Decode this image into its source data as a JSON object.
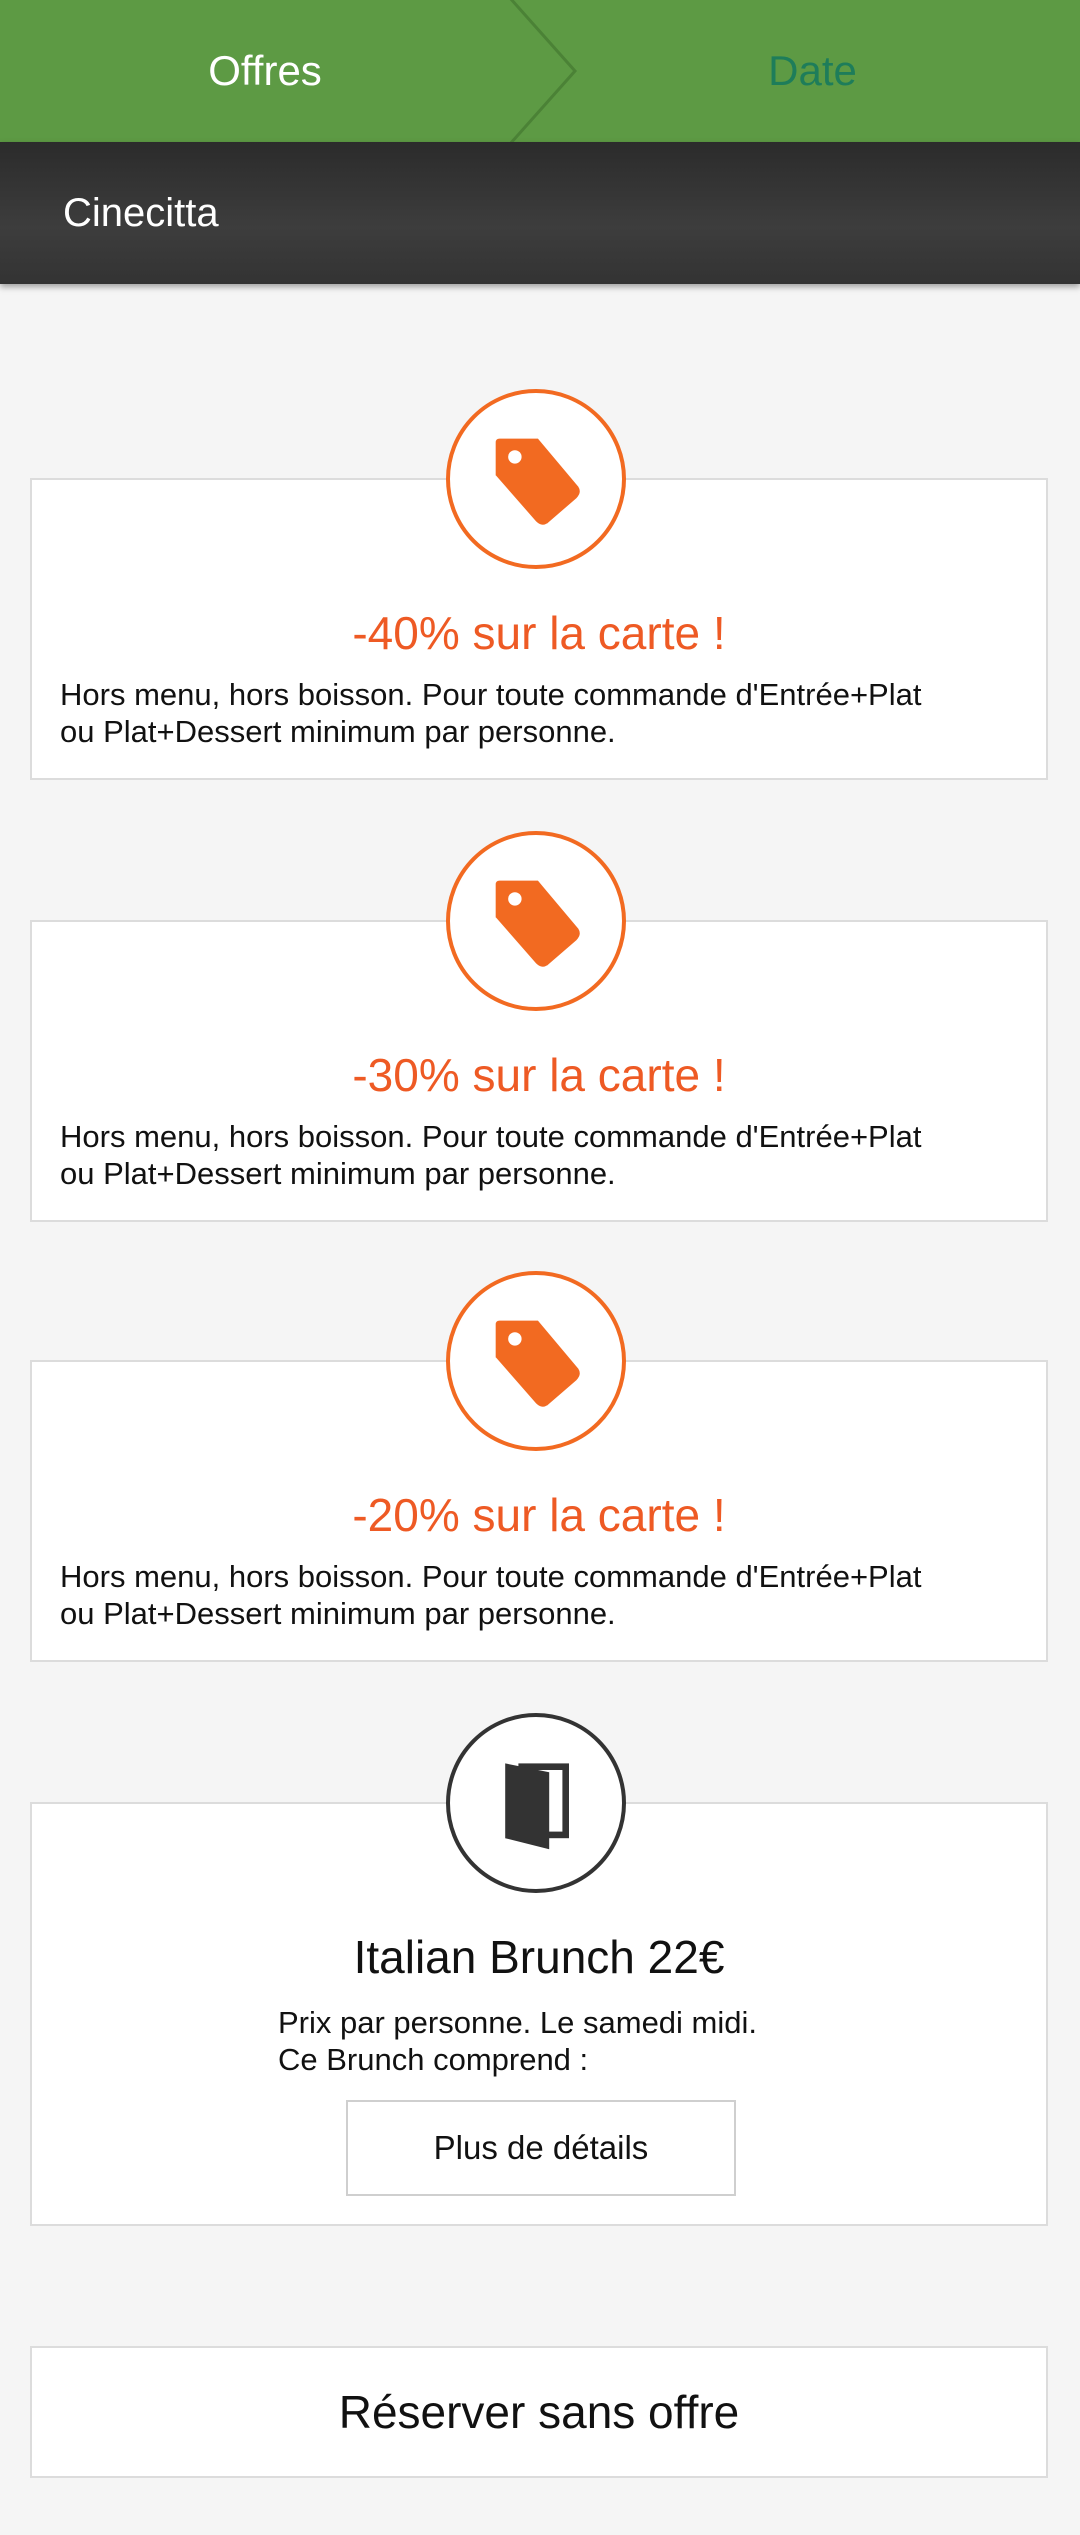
{
  "tabs": {
    "offres": "Offres",
    "date": "Date"
  },
  "restaurant": "Cinecitta",
  "offers": [
    {
      "title": "-40% sur la carte !",
      "line1": "Hors menu, hors boisson. Pour toute commande d'Entrée+Plat",
      "line2": "ou Plat+Dessert minimum par personne.",
      "icon": "tag-icon"
    },
    {
      "title": "-30% sur la carte !",
      "line1": "Hors menu, hors boisson. Pour toute commande d'Entrée+Plat",
      "line2": "ou Plat+Dessert minimum par personne.",
      "icon": "tag-icon"
    },
    {
      "title": "-20% sur la carte !",
      "line1": "Hors menu, hors boisson. Pour toute commande d'Entrée+Plat",
      "line2": "ou Plat+Dessert minimum par personne.",
      "icon": "tag-icon"
    }
  ],
  "brunch": {
    "title": "Italian Brunch 22€",
    "line1": "Prix par personne. Le samedi midi.",
    "line2": "Ce Brunch comprend :",
    "details_label": "Plus de détails",
    "icon": "menu-book-icon"
  },
  "reserve_label": "Réserver sans offre",
  "colors": {
    "green": "#5d9a44",
    "accent": "#f26a21",
    "offer_text": "#ee5a24",
    "dark_header": "#333333"
  }
}
